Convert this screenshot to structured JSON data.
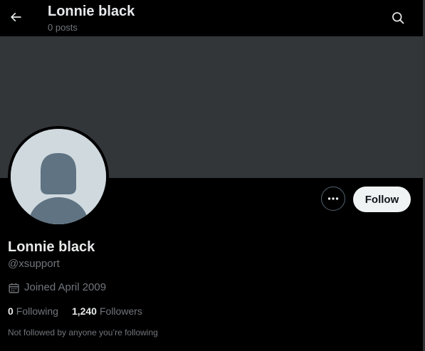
{
  "header": {
    "title": "Lonnie black",
    "posts_count": "0 posts",
    "back_icon": "arrow-left-icon",
    "search_icon": "search-icon"
  },
  "profile": {
    "display_name": "Lonnie black",
    "handle": "@xsupport",
    "joined": "Joined April 2009",
    "joined_icon": "calendar-icon",
    "following_count": "0",
    "following_label": "Following",
    "followers_count": "1,240",
    "followers_label": "Followers",
    "not_followed_text": "Not followed by anyone you’re following"
  },
  "actions": {
    "follow_label": "Follow",
    "more_icon": "more-dots-icon"
  },
  "colors": {
    "background": "#000000",
    "banner": "#333639",
    "avatar_bg": "#cfd9de",
    "avatar_silhouette": "#5f7382",
    "text_primary": "#e7e9ea",
    "text_secondary": "#71767b",
    "follow_button_bg": "#eff3f4"
  }
}
